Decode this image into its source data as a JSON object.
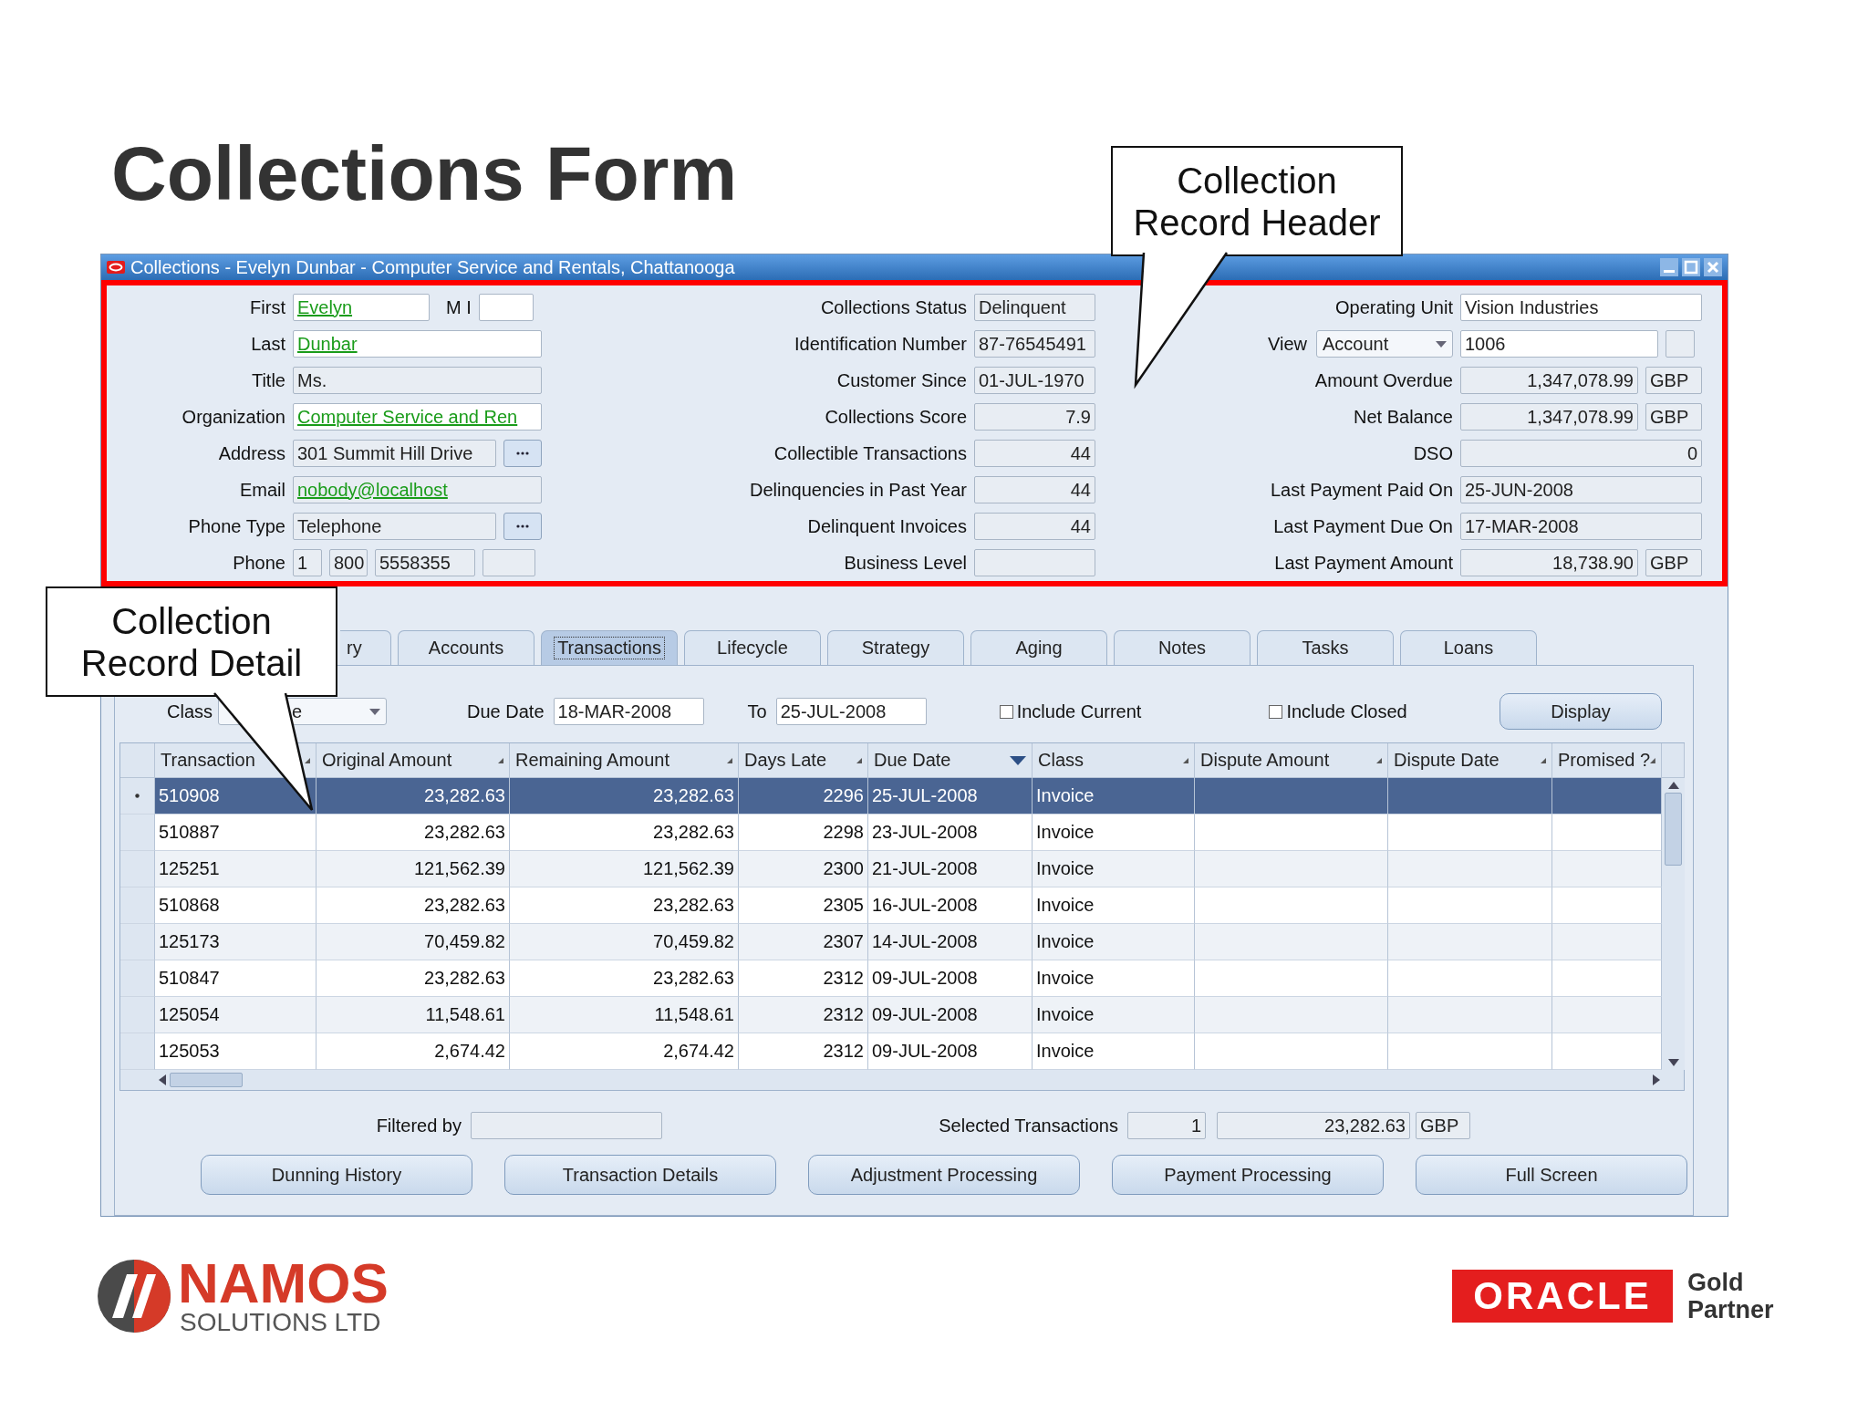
{
  "slide_title": "Collections Form",
  "callouts": [
    {
      "text": "Collection Record Header"
    },
    {
      "text": "Collection Record Detail"
    }
  ],
  "window": {
    "title": "Collections - Evelyn Dunbar - Computer Service and Rentals, Chattanooga"
  },
  "header": {
    "column_1": [
      {
        "label": "First",
        "kind": "name",
        "fields": [
          {
            "kind": "text",
            "value": "Evelyn",
            "editable": true,
            "link": true
          },
          {
            "kind": "text",
            "label": "M I",
            "editable": true
          }
        ]
      },
      {
        "label": "Last",
        "kind": "plain",
        "fields": [
          {
            "kind": "text",
            "value": "Dunbar",
            "editable": true,
            "link": true
          }
        ]
      },
      {
        "label": "Title",
        "kind": "plain",
        "fields": [
          {
            "kind": "text",
            "value": "Ms.",
            "editable": false,
            "link": false
          }
        ]
      },
      {
        "label": "Organization",
        "kind": "plain",
        "fields": [
          {
            "kind": "text",
            "value": "Computer Service and Ren",
            "editable": true,
            "link": true
          }
        ]
      },
      {
        "label": "Address",
        "kind": "lookup",
        "fields": [
          {
            "kind": "text",
            "value": "301 Summit Hill Drive",
            "editable": false,
            "link": false
          }
        ]
      },
      {
        "label": "Email",
        "kind": "plain",
        "fields": [
          {
            "kind": "text",
            "value": "nobody@localhost",
            "editable": false,
            "link": true
          }
        ]
      },
      {
        "label": "Phone Type",
        "kind": "lookup",
        "fields": [
          {
            "kind": "text",
            "value": "Telephone",
            "editable": false,
            "link": false
          }
        ]
      },
      {
        "label": "Phone",
        "kind": "phone",
        "fields": [
          {
            "kind": "text",
            "value": "1",
            "editable": false,
            "link": false
          },
          {
            "kind": "text",
            "value": "800",
            "editable": false,
            "link": false
          },
          {
            "kind": "text",
            "value": "5558355",
            "editable": false,
            "link": false
          },
          {
            "kind": "text",
            "editable": false
          }
        ]
      }
    ],
    "column_2": [
      {
        "label": "Collections Status",
        "kind": "plain",
        "fields": [
          {
            "kind": "text",
            "value": "Delinquent",
            "editable": false
          }
        ]
      },
      {
        "label": "Identification Number",
        "kind": "plain",
        "fields": [
          {
            "kind": "text",
            "value": "87-76545491",
            "editable": false
          }
        ]
      },
      {
        "label": "Customer Since",
        "kind": "plain",
        "fields": [
          {
            "kind": "text",
            "value": "01-JUL-1970",
            "editable": false
          }
        ]
      },
      {
        "label": "Collections Score",
        "kind": "plain",
        "fields": [
          {
            "kind": "number",
            "value": "7.9",
            "editable": false
          }
        ]
      },
      {
        "label": "Collectible Transactions",
        "kind": "plain",
        "fields": [
          {
            "kind": "number",
            "value": "44",
            "editable": false
          }
        ]
      },
      {
        "label": "Delinquencies in Past Year",
        "kind": "plain",
        "fields": [
          {
            "kind": "number",
            "value": "44",
            "editable": false
          }
        ]
      },
      {
        "label": "Delinquent Invoices",
        "kind": "plain",
        "fields": [
          {
            "kind": "number",
            "value": "44",
            "editable": false
          }
        ]
      },
      {
        "label": "Business Level",
        "kind": "plain",
        "fields": [
          {
            "kind": "text",
            "editable": false
          }
        ]
      }
    ],
    "column_3": [
      {
        "label": "Operating Unit",
        "kind": "plain",
        "fields": [
          {
            "kind": "text",
            "value": "Vision Industries",
            "editable": true
          }
        ]
      },
      {
        "label": "View",
        "kind": "view",
        "fields": [
          {
            "kind": "select",
            "value": "Account",
            "editable": true
          },
          {
            "kind": "text",
            "value": "1006",
            "editable": true
          },
          {
            "kind": "text",
            "editable": false
          }
        ]
      },
      {
        "label": "Amount Overdue",
        "kind": "amount",
        "fields": [
          {
            "kind": "number",
            "value": "1,347,078.99",
            "editable": false
          },
          {
            "kind": "text",
            "value": "GBP",
            "editable": false
          }
        ]
      },
      {
        "label": "Net Balance",
        "kind": "amount",
        "fields": [
          {
            "kind": "number",
            "value": "1,347,078.99",
            "editable": false
          },
          {
            "kind": "text",
            "value": "GBP",
            "editable": false
          }
        ]
      },
      {
        "label": "DSO",
        "kind": "plain",
        "fields": [
          {
            "kind": "number",
            "value": "0",
            "editable": false
          }
        ]
      },
      {
        "label": "Last Payment Paid On",
        "kind": "plain",
        "fields": [
          {
            "kind": "text",
            "value": "25-JUN-2008",
            "editable": false
          }
        ]
      },
      {
        "label": "Last Payment Due On",
        "kind": "plain",
        "fields": [
          {
            "kind": "text",
            "value": "17-MAR-2008",
            "editable": false
          }
        ]
      },
      {
        "label": "Last Payment Amount",
        "kind": "amount",
        "fields": [
          {
            "kind": "number",
            "value": "18,738.90",
            "editable": false
          },
          {
            "kind": "text",
            "value": "GBP",
            "editable": false
          }
        ]
      }
    ]
  },
  "detail": {
    "tabs": [
      {
        "label": "ry",
        "selected": false
      },
      {
        "label": "Accounts",
        "selected": false
      },
      {
        "label": "Transactions",
        "selected": true
      },
      {
        "label": "Lifecycle",
        "selected": false
      },
      {
        "label": "Strategy",
        "selected": false
      },
      {
        "label": "Aging",
        "selected": false
      },
      {
        "label": "Notes",
        "selected": false
      },
      {
        "label": "Tasks",
        "selected": false
      },
      {
        "label": "Loans",
        "selected": false
      }
    ],
    "filters": {
      "class": {
        "label": "Class",
        "value": "e"
      },
      "due_date": {
        "label": "Due Date",
        "value": "18-MAR-2008"
      },
      "to": {
        "label": "To",
        "value": "25-JUL-2008"
      },
      "checkboxes": [
        {
          "label": "Include Current",
          "checked": false
        },
        {
          "label": "Include Closed",
          "checked": false
        }
      ],
      "display_button": "Display"
    },
    "table": {
      "columns": [
        {
          "label": "Transaction",
          "sorted": false
        },
        {
          "label": "Original Amount",
          "sorted": false
        },
        {
          "label": "Remaining Amount",
          "sorted": false
        },
        {
          "label": "Days Late",
          "sorted": false
        },
        {
          "label": "Due Date",
          "sorted": true
        },
        {
          "label": "Class",
          "sorted": false
        },
        {
          "label": "Dispute Amount",
          "sorted": false
        },
        {
          "label": "Dispute Date",
          "sorted": false
        },
        {
          "label": "Promised ?",
          "sorted": false
        }
      ],
      "rows": [
        {
          "selected": true,
          "cells": [
            "510908",
            "23,282.63",
            "23,282.63",
            "2296",
            "25-JUL-2008",
            "Invoice"
          ]
        },
        {
          "selected": false,
          "cells": [
            "510887",
            "23,282.63",
            "23,282.63",
            "2298",
            "23-JUL-2008",
            "Invoice"
          ]
        },
        {
          "selected": false,
          "cells": [
            "125251",
            "121,562.39",
            "121,562.39",
            "2300",
            "21-JUL-2008",
            "Invoice"
          ]
        },
        {
          "selected": false,
          "cells": [
            "510868",
            "23,282.63",
            "23,282.63",
            "2305",
            "16-JUL-2008",
            "Invoice"
          ]
        },
        {
          "selected": false,
          "cells": [
            "125173",
            "70,459.82",
            "70,459.82",
            "2307",
            "14-JUL-2008",
            "Invoice"
          ]
        },
        {
          "selected": false,
          "cells": [
            "510847",
            "23,282.63",
            "23,282.63",
            "2312",
            "09-JUL-2008",
            "Invoice"
          ]
        },
        {
          "selected": false,
          "cells": [
            "125054",
            "11,548.61",
            "11,548.61",
            "2312",
            "09-JUL-2008",
            "Invoice"
          ]
        },
        {
          "selected": false,
          "cells": [
            "125053",
            "2,674.42",
            "2,674.42",
            "2312",
            "09-JUL-2008",
            "Invoice"
          ]
        }
      ]
    },
    "filtered_by": {
      "label": "Filtered by"
    },
    "selected_transactions": {
      "label": "Selected Transactions",
      "count": "1",
      "amount": "23,282.63",
      "currency": "GBP"
    },
    "buttons": [
      "Dunning History",
      "Transaction Details",
      "Adjustment Processing",
      "Payment Processing",
      "Full Screen"
    ]
  },
  "footer": {
    "namos": {
      "name": "NAMOS",
      "tagline": "SOLUTIONS LTD"
    },
    "oracle": {
      "name": "ORACLE",
      "badge": "Gold Partner"
    }
  }
}
